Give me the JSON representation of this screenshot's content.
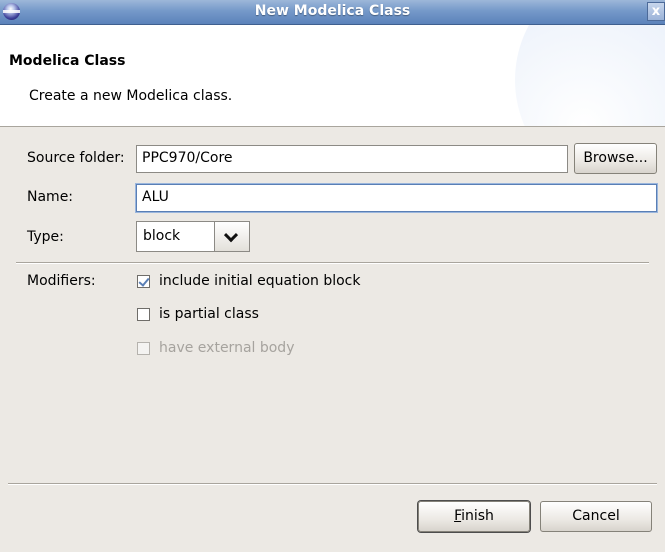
{
  "window": {
    "title": "New Modelica Class",
    "close_label": "x"
  },
  "banner": {
    "title": "Modelica Class",
    "description": "Create a new Modelica class."
  },
  "form": {
    "source_folder": {
      "label": "Source folder:",
      "value": "PPC970/Core",
      "browse_label": "Browse..."
    },
    "name": {
      "label": "Name:",
      "value": "ALU"
    },
    "type": {
      "label": "Type:",
      "value": "block"
    },
    "modifiers": {
      "label": "Modifiers:",
      "options": [
        {
          "label": "include initial equation block",
          "checked": true,
          "enabled": true
        },
        {
          "label": "is partial class",
          "checked": false,
          "enabled": true
        },
        {
          "label": "have external body",
          "checked": false,
          "enabled": false
        }
      ]
    }
  },
  "buttons": {
    "finish": {
      "mnemonic": "F",
      "rest": "inish"
    },
    "cancel": "Cancel"
  },
  "colors": {
    "title_bar": "#7599c9",
    "dialog_background": "#ece9e4",
    "focus_border": "#5a7fb5"
  }
}
